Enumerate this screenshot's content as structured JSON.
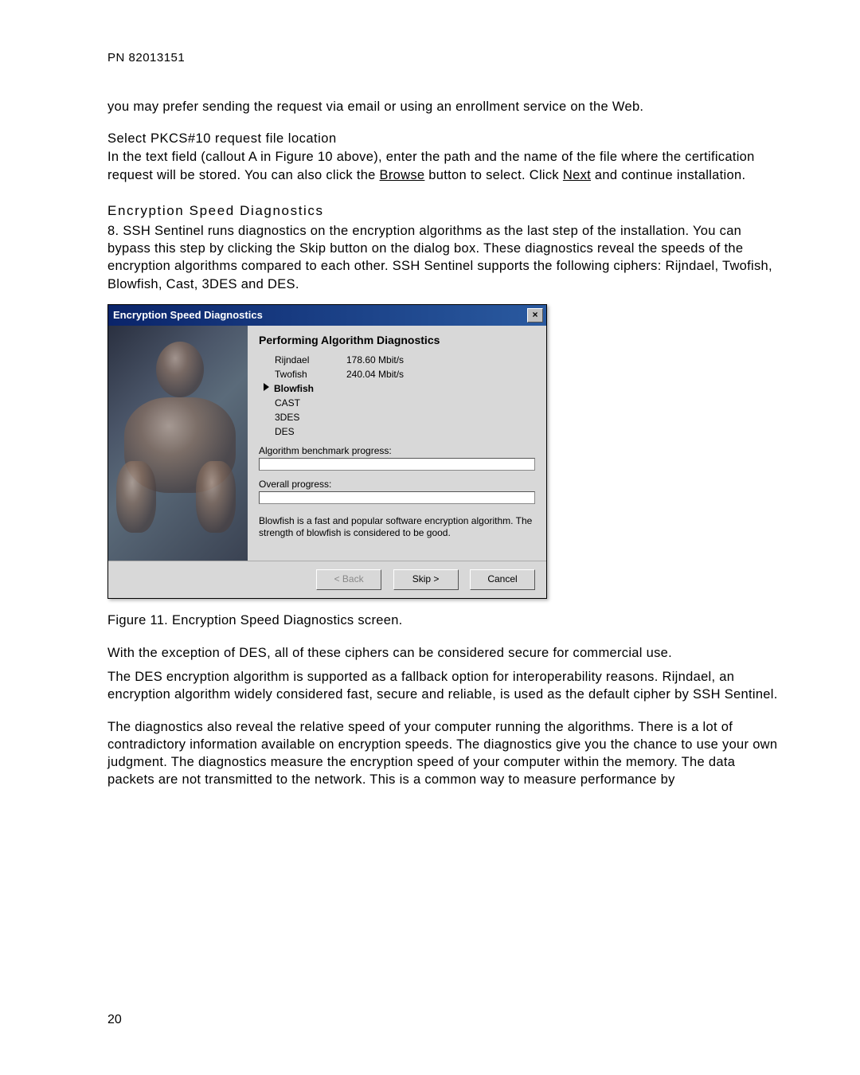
{
  "header": {
    "pn": "PN 82013151"
  },
  "intro": {
    "p1": "you may prefer sending the request via email or using an enrollment service on the Web."
  },
  "section1": {
    "heading": "Select PKCS#10 request file location",
    "p1a": "In the text field (callout A in Figure 10 above), enter the path and the name of the file where the certification request will be stored.  You can also click the ",
    "browse": "Browse",
    "p1b": " button to select.  Click ",
    "next": "Next",
    "p1c": " and continue installation."
  },
  "section2": {
    "heading": "Encryption Speed Diagnostics",
    "p1": "8.  SSH Sentinel runs diagnostics on the encryption algorithms as the last step of the installation. You can bypass this step by clicking the Skip button on the dialog box. These diagnostics reveal the speeds of the encryption algorithms compared to each other. SSH Sentinel supports the following ciphers: Rijndael, Twofish, Blowfish, Cast, 3DES and DES."
  },
  "dialog": {
    "title": "Encryption Speed Diagnostics",
    "heading": "Performing Algorithm Diagnostics",
    "algorithms": [
      {
        "name": "Rijndael",
        "speed": "178.60 Mbit/s"
      },
      {
        "name": "Twofish",
        "speed": "240.04 Mbit/s"
      },
      {
        "name": "Blowfish",
        "speed": ""
      },
      {
        "name": "CAST",
        "speed": ""
      },
      {
        "name": "3DES",
        "speed": ""
      },
      {
        "name": "DES",
        "speed": ""
      }
    ],
    "progress_label1": "Algorithm benchmark progress:",
    "progress_label2": "Overall progress:",
    "description": "Blowfish is a fast and popular software encryption algorithm. The strength of blowfish is considered to be good.",
    "buttons": {
      "back": "< Back",
      "skip": "Skip >",
      "cancel": "Cancel"
    }
  },
  "figure": {
    "caption": "Figure 11.  Encryption Speed Diagnostics screen."
  },
  "after": {
    "p1": "With the exception of DES, all of these ciphers can be considered secure for commercial use.",
    "p2": "The DES encryption algorithm is supported as a fallback option for interoperability reasons. Rijndael, an encryption algorithm widely considered fast, secure and reliable, is used as the default cipher by SSH Sentinel.",
    "p3": "The diagnostics also reveal the relative speed of your computer running the algorithms. There is a lot of contradictory information available on encryption speeds. The diagnostics give you the chance to use your own judgment. The diagnostics measure the encryption speed of your computer within the memory. The data packets are not transmitted to the network. This is a common way to measure performance by"
  },
  "page_number": "20"
}
